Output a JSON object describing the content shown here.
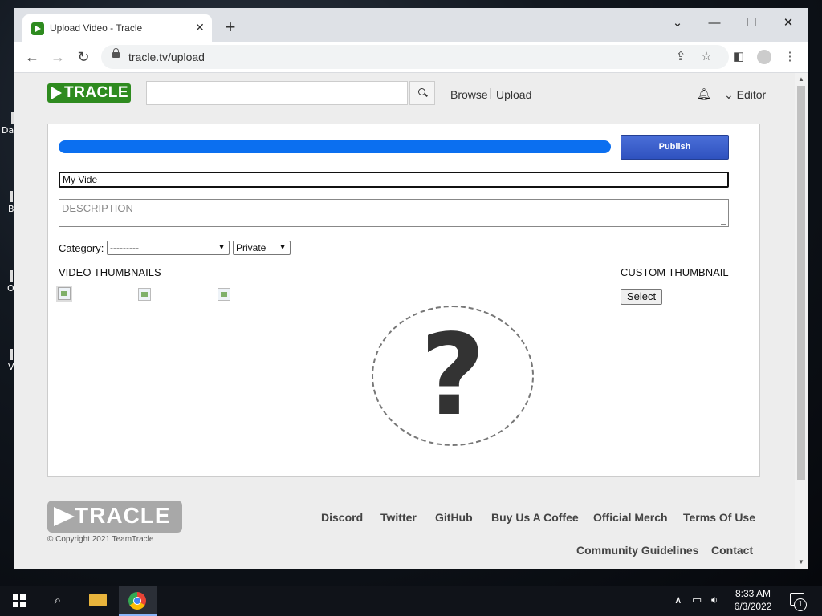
{
  "browser": {
    "tab_title": "Upload Video - Tracle",
    "tab_close": "✕",
    "new_tab": "+",
    "url": "tracle.tv/upload",
    "window_controls": {
      "dropdown": "⌄",
      "minimize": "—",
      "maximize": "☐",
      "close": "✕"
    }
  },
  "desktop": {
    "icons": [
      {
        "label": "Da"
      },
      {
        "label": "B"
      },
      {
        "label": "O"
      },
      {
        "label": "V"
      }
    ]
  },
  "header": {
    "logo_text": "TRACLE",
    "search_placeholder": "",
    "nav": {
      "browse": "Browse",
      "upload": "Upload"
    },
    "user_menu": "Editor",
    "user_menu_chevron": "⌄"
  },
  "upload_form": {
    "progress": 1.0,
    "publish_label": "Publish",
    "title_value": "My Vide",
    "description_placeholder": "DESCRIPTION",
    "category_label": "Category:",
    "category_selected": "---------",
    "privacy_selected": "Private",
    "video_thumbnails_label": "VIDEO THUMBNAILS",
    "custom_thumbnail_label": "CUSTOM THUMBNAIL",
    "select_button": "Select",
    "placeholder_glyph": "?"
  },
  "footer": {
    "logo_text": "TRACLE",
    "copyright": "© Copyright 2021 TeamTracle",
    "links": [
      "Discord",
      "Twitter",
      "GitHub",
      "Buy Us A Coffee",
      "Official Merch",
      "Terms Of Use",
      "Community Guidelines",
      "Contact"
    ]
  },
  "taskbar": {
    "time": "8:33 AM",
    "date": "6/3/2022",
    "notification_count": "1"
  },
  "colors": {
    "brand_green": "#2e8b1f",
    "progress_blue": "#0b6ff0",
    "publish_blue": "#3a5fcd"
  }
}
